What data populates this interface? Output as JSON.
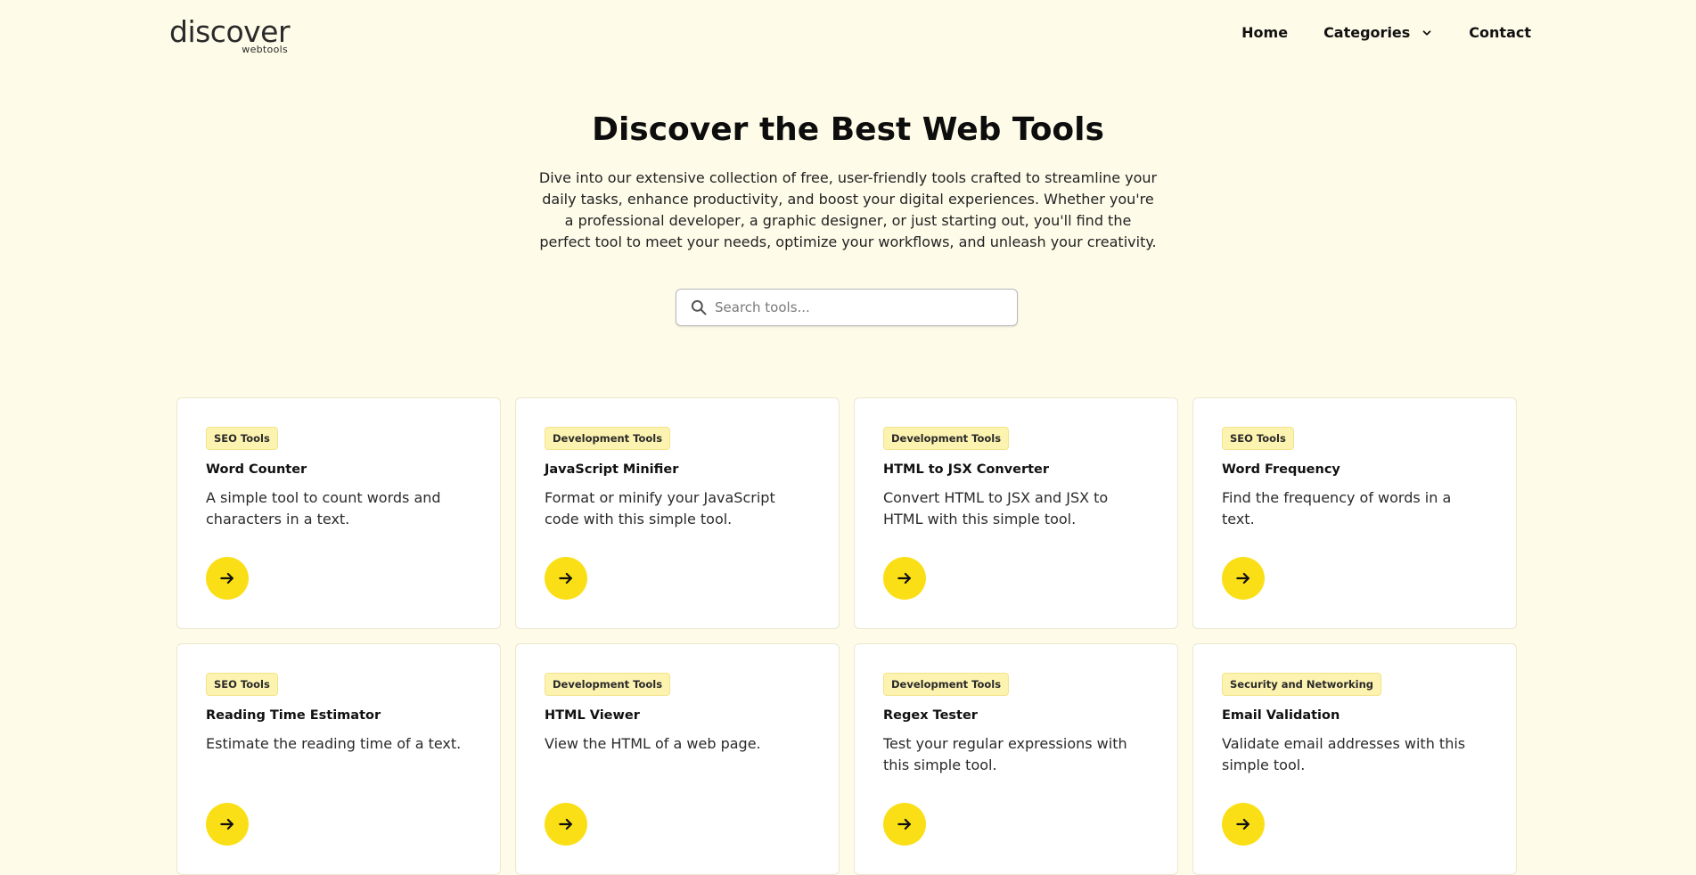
{
  "brand": {
    "logo_word": "discover",
    "logo_sub": "webtools",
    "accent": "#fadf17",
    "background": "#fefbe9"
  },
  "nav": {
    "home": "Home",
    "categories": "Categories",
    "contact": "Contact"
  },
  "hero": {
    "title": "Discover the Best Web Tools",
    "description": "Dive into our extensive collection of free, user-friendly tools crafted to streamline your daily tasks, enhance productivity, and boost your digital experiences. Whether you're a professional developer, a graphic designer, or just starting out, you'll find the perfect tool to meet your needs, optimize your workflows, and unleash your creativity."
  },
  "search": {
    "placeholder": "Search tools...",
    "value": "",
    "icon": "search-icon"
  },
  "tools": [
    {
      "category": "SEO Tools",
      "title": "Word Counter",
      "description": "A simple tool to count words and characters in a text.",
      "icon": "arrow-right-icon"
    },
    {
      "category": "Development Tools",
      "title": "JavaScript Minifier",
      "description": "Format or minify your JavaScript code with this simple tool.",
      "icon": "arrow-right-icon"
    },
    {
      "category": "Development Tools",
      "title": "HTML to JSX Converter",
      "description": "Convert HTML to JSX and JSX to HTML with this simple tool.",
      "icon": "arrow-right-icon"
    },
    {
      "category": "SEO Tools",
      "title": "Word Frequency",
      "description": "Find the frequency of words in a text.",
      "icon": "arrow-right-icon"
    },
    {
      "category": "SEO Tools",
      "title": "Reading Time Estimator",
      "description": "Estimate the reading time of a text.",
      "icon": "arrow-right-icon"
    },
    {
      "category": "Development Tools",
      "title": "HTML Viewer",
      "description": "View the HTML of a web page.",
      "icon": "arrow-right-icon"
    },
    {
      "category": "Development Tools",
      "title": "Regex Tester",
      "description": "Test your regular expressions with this simple tool.",
      "icon": "arrow-right-icon"
    },
    {
      "category": "Security and Networking",
      "title": "Email Validation",
      "description": "Validate email addresses with this simple tool.",
      "icon": "arrow-right-icon"
    }
  ]
}
